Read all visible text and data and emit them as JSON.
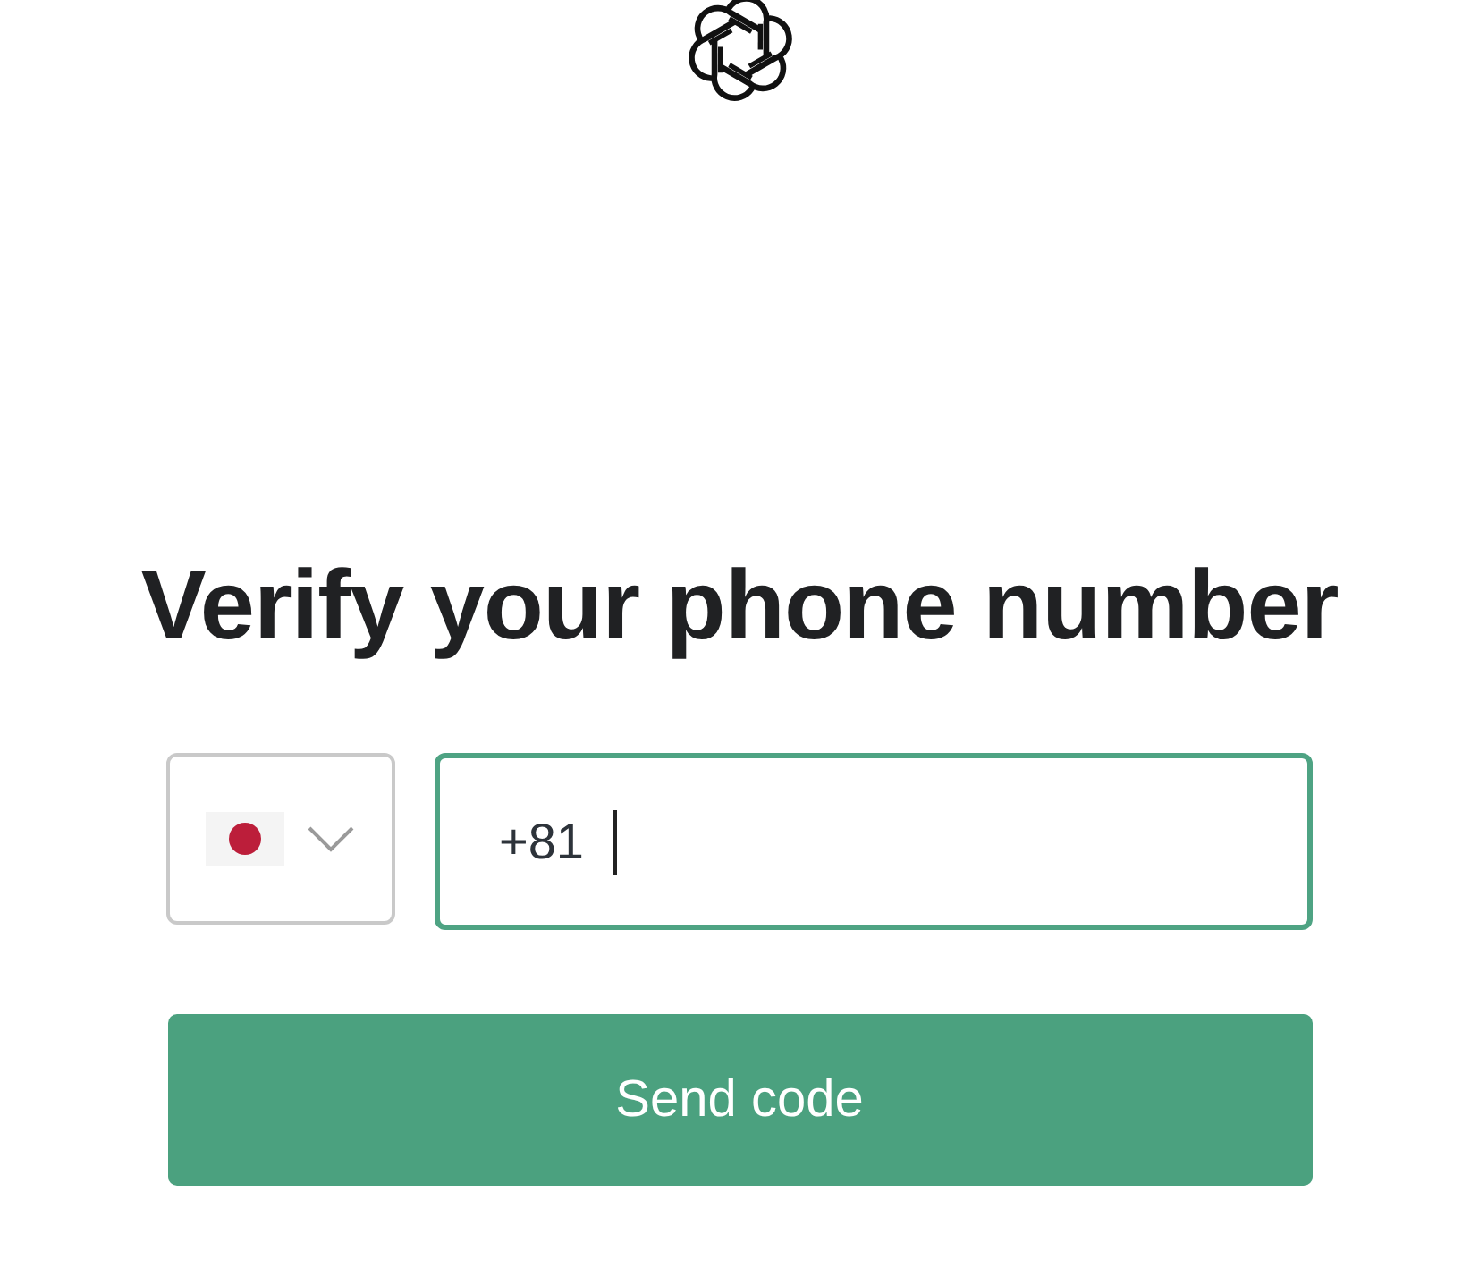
{
  "heading": "Verify your phone number",
  "country_select": {
    "expanded": false
  },
  "phone_field": {
    "value": "+81",
    "focused": true
  },
  "submit_button": {
    "label": "Send code"
  }
}
